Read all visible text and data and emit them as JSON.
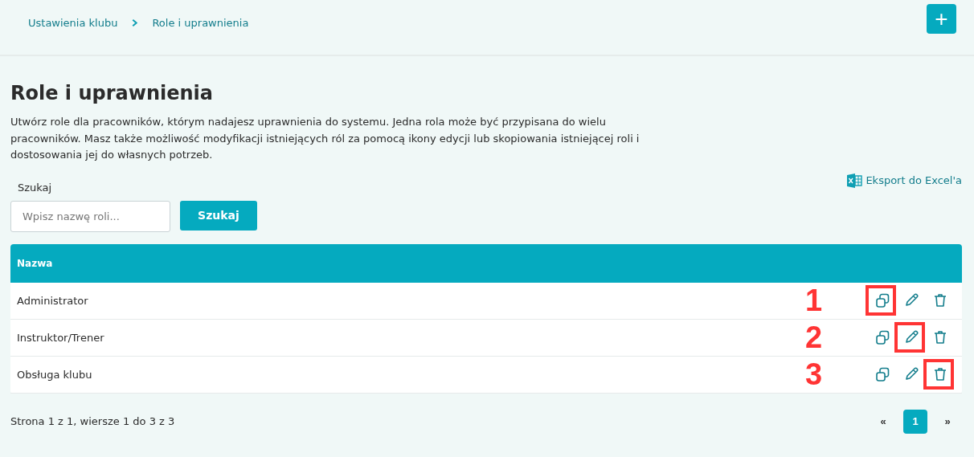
{
  "breadcrumb": [
    {
      "label": "Ustawienia klubu"
    },
    {
      "label": "Role i uprawnienia"
    }
  ],
  "add_button": {
    "label": "+"
  },
  "title": "Role i uprawnienia",
  "description": "Utwórz role dla pracowników, którym nadajesz uprawnienia do systemu. Jedna rola może być przypisana do wielu pracowników. Masz także możliwość modyfikacji istniejących ról za pomocą ikony edycji lub skopiowania istniejącej roli i dostosowania jej do własnych potrzeb.",
  "search": {
    "label": "Szukaj",
    "placeholder": "Wpisz nazwę roli...",
    "button": "Szukaj"
  },
  "export_link": "Eksport do Excel'a",
  "table": {
    "columns": [
      "Nazwa"
    ],
    "rows": [
      {
        "name": "Administrator",
        "marker": "1",
        "actions": [
          {
            "kind": "copy",
            "highlighted": true
          },
          {
            "kind": "edit",
            "highlighted": false
          },
          {
            "kind": "delete",
            "highlighted": false
          }
        ]
      },
      {
        "name": "Instruktor/Trener",
        "marker": "2",
        "actions": [
          {
            "kind": "copy",
            "highlighted": false
          },
          {
            "kind": "edit",
            "highlighted": true
          },
          {
            "kind": "delete",
            "highlighted": false
          }
        ]
      },
      {
        "name": "Obsługa klubu",
        "marker": "3",
        "actions": [
          {
            "kind": "copy",
            "highlighted": false
          },
          {
            "kind": "edit",
            "highlighted": false
          },
          {
            "kind": "delete",
            "highlighted": true
          }
        ]
      }
    ]
  },
  "footer": {
    "summary": "Strona 1 z 1, wiersze 1 do 3 z 3",
    "pagination": [
      {
        "label": "«",
        "selected": false
      },
      {
        "label": "1",
        "selected": true
      },
      {
        "label": "»",
        "selected": false
      }
    ]
  }
}
